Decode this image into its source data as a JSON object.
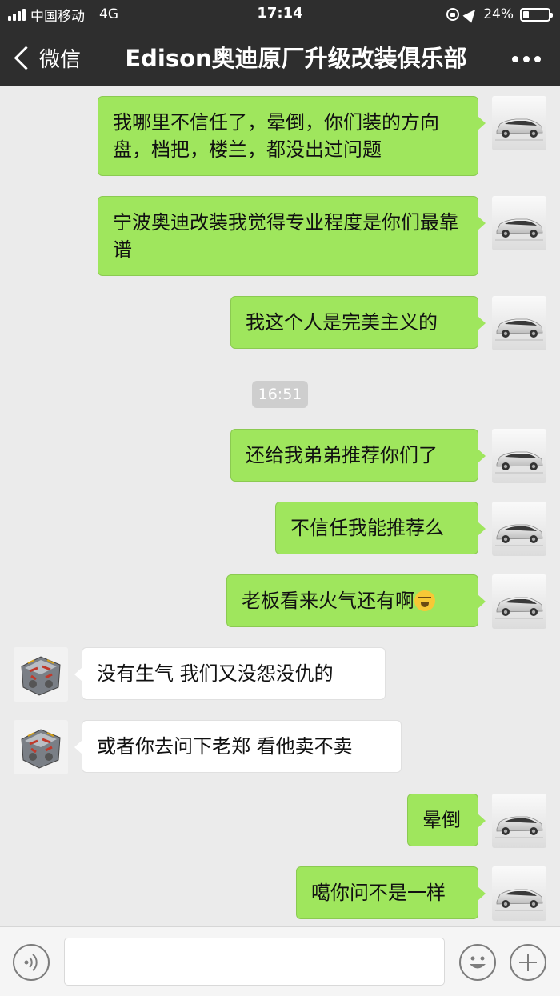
{
  "status_bar": {
    "carrier": "中国移动",
    "network": "4G",
    "time": "17:14",
    "battery": "24%",
    "battery_level": 0.24
  },
  "nav": {
    "back_label": "微信",
    "title": "Edison奥迪原厂升级改装俱乐部"
  },
  "messages": [
    {
      "side": "out",
      "text": "我哪里不信任了，晕倒，你们装的方向盘，档把，楼兰，都没出过问题"
    },
    {
      "side": "out",
      "text": "宁波奥迪改装我觉得专业程度是你们最靠谱"
    },
    {
      "side": "out",
      "text": "我这个人是完美主义的"
    },
    {
      "timestamp": "16:51"
    },
    {
      "side": "out",
      "text": "还给我弟弟推荐你们了"
    },
    {
      "side": "out",
      "text": "不信任我能推荐么"
    },
    {
      "side": "out",
      "text": "老板看来火气还有啊",
      "emoji": "face-with-hand-over-mouth-icon"
    },
    {
      "side": "in",
      "text": "没有生气 我们又没怨没仇的"
    },
    {
      "side": "in",
      "text": "或者你去问下老郑 看他卖不卖"
    },
    {
      "side": "out",
      "text": "晕倒"
    },
    {
      "side": "out",
      "text": "噶你问不是一样"
    }
  ],
  "colors": {
    "nav_bg": "#2e2e2e",
    "chat_bg": "#ebebeb",
    "outgoing_bubble": "#9fe65d",
    "incoming_bubble": "#ffffff"
  }
}
